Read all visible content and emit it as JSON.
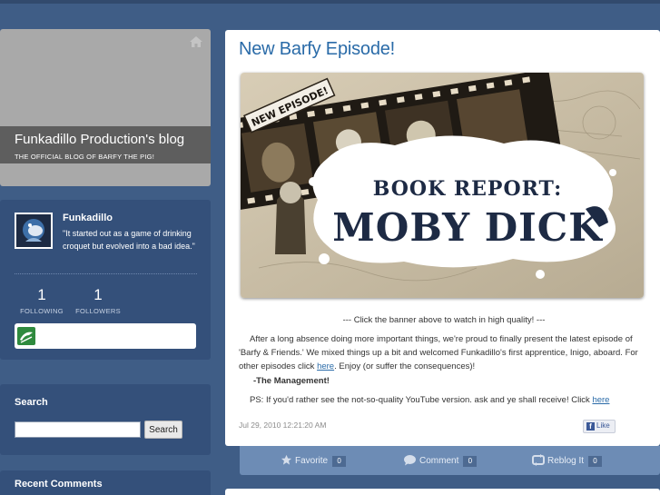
{
  "sidebar": {
    "blog_title": "Funkadillo Production's blog",
    "blog_subtitle": "THE OFFICIAL BLOG OF BARFY THE PIG!",
    "profile": {
      "name": "Funkadillo",
      "quote": "\"It started out as a game of drinking croquet but evolved into a bad idea.\"",
      "following_count": "1",
      "following_label": "FOLLOWING",
      "followers_count": "1",
      "followers_label": "FOLLOWERS"
    },
    "search": {
      "title": "Search",
      "input_value": "",
      "button_label": "Search"
    },
    "recent_comments": {
      "title": "Recent Comments"
    }
  },
  "post": {
    "title": "New Barfy Episode!",
    "banner": {
      "ribbon_text": "NEW EPISODE!",
      "line1": "BOOK REPORT:",
      "line2": "MOBY DICK"
    },
    "caption": "--- Click the banner above to watch in high quality! ---",
    "paragraph_before_link": "After a long absence doing more important things, we're proud to finally present the latest episode of 'Barfy & Friends.' We mixed things up a bit and welcomed Funkadillo's first apprentice, Inigo, aboard.  For other episodes click ",
    "paragraph_link": "here",
    "paragraph_after_link": ".  Enjoy (or suffer the consequences)!",
    "signoff": "-The Management!",
    "ps_before_link": "PS:  If you'd rather see the not-so-quality YouTube version. ask and ye shall receive! Click ",
    "ps_link": "here",
    "date": "Jul 29, 2010 12:21:20 AM",
    "like_label": "Like"
  },
  "actions": {
    "favorite_label": "Favorite",
    "favorite_count": "0",
    "comment_label": "Comment",
    "comment_count": "0",
    "reblog_label": "Reblog It",
    "reblog_count": "0"
  },
  "colors": {
    "page_background": "#3f5d86",
    "widget_background": "#34507a",
    "link": "#2a6ba8",
    "action_bar": "#6d8cb5"
  }
}
